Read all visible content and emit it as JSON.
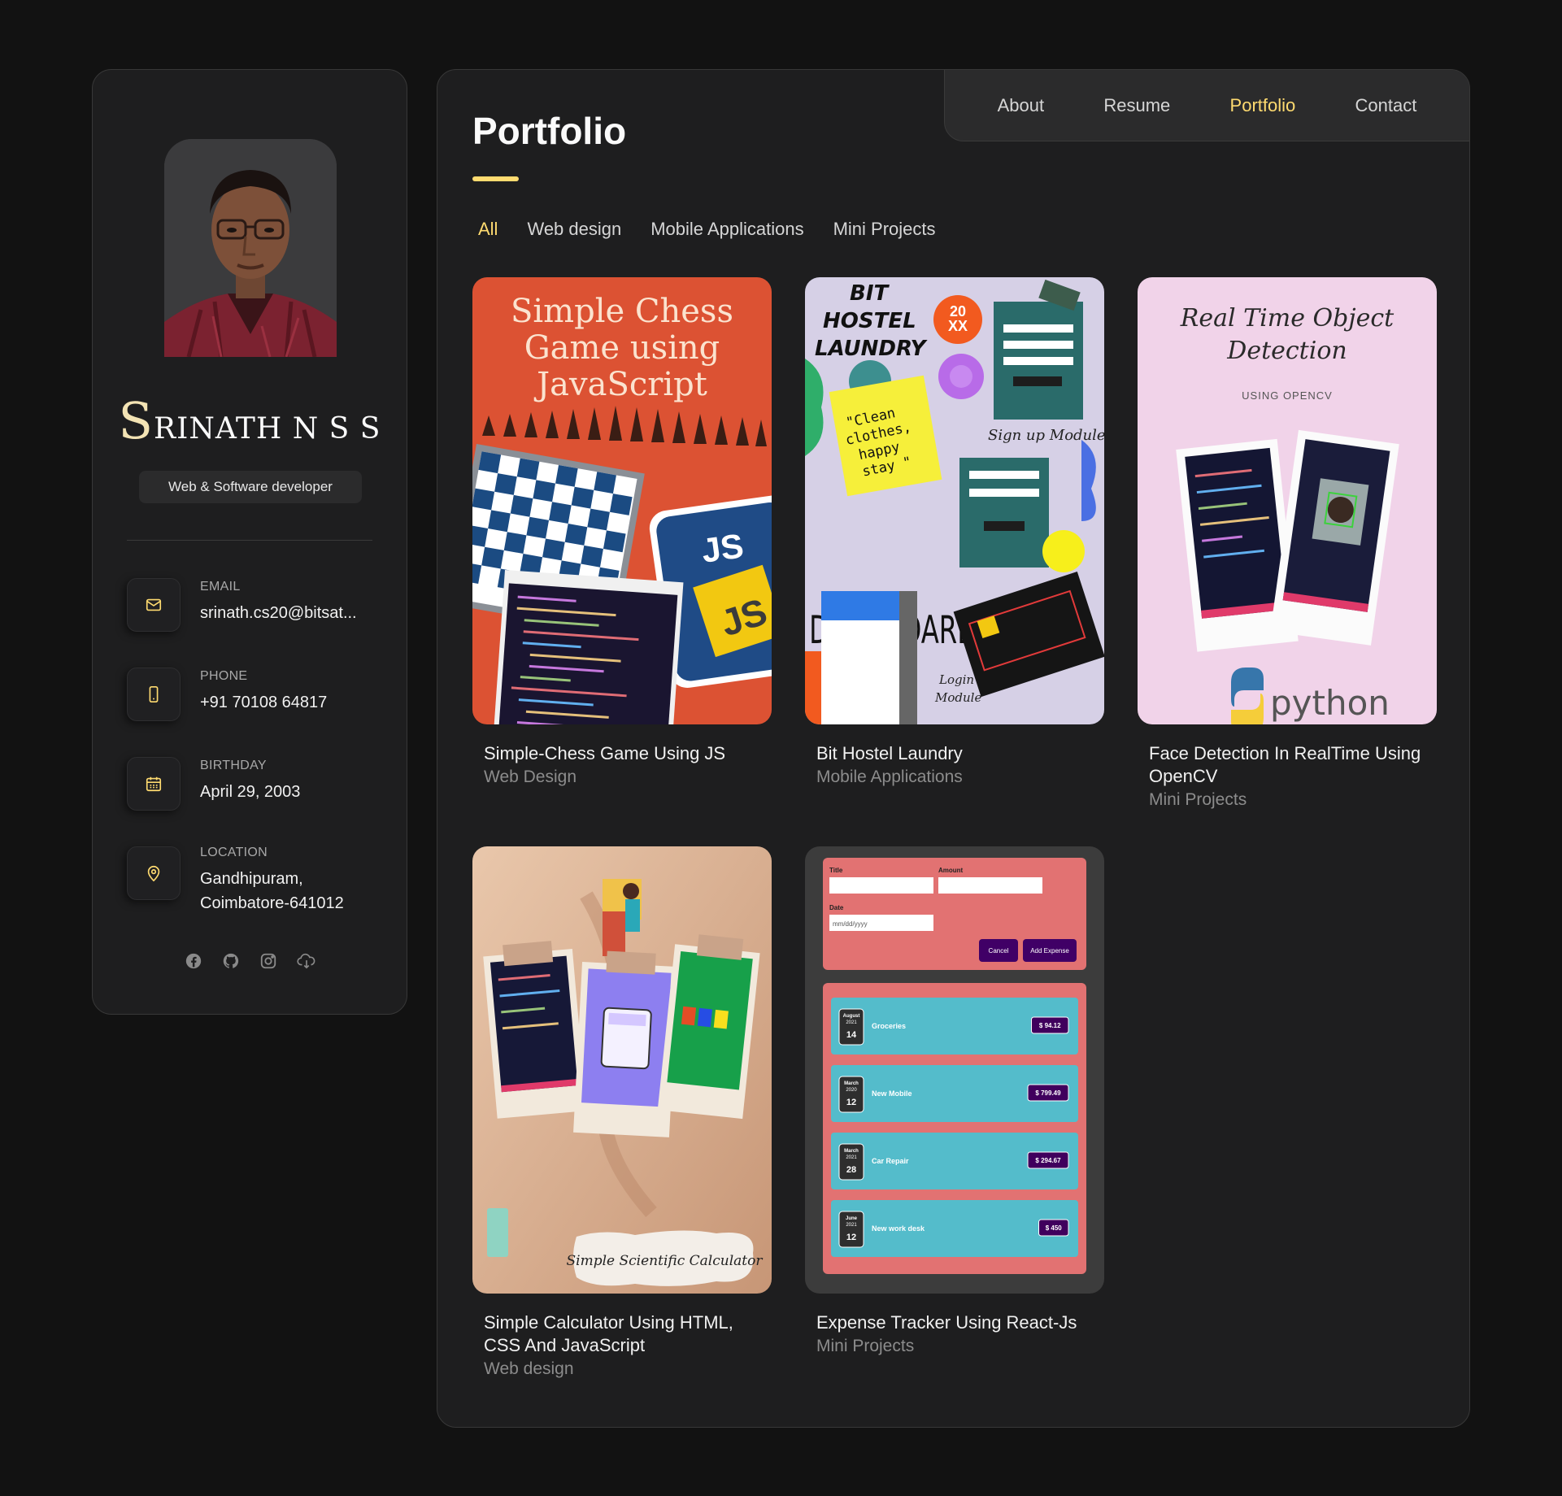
{
  "profile": {
    "name_initial": "S",
    "name_rest": "RINATH N S S",
    "title": "Web & Software developer"
  },
  "contacts": [
    {
      "label": "EMAIL",
      "value": "srinath.cs20@bitsat..."
    },
    {
      "label": "PHONE",
      "value": "+91 70108 64817"
    },
    {
      "label": "BIRTHDAY",
      "value": "April 29, 2003"
    },
    {
      "label": "LOCATION",
      "value": "Gandhipuram,",
      "value2": "Coimbatore-641012"
    }
  ],
  "socials": [
    "facebook-icon",
    "github-icon",
    "instagram-icon",
    "cloud-download-icon"
  ],
  "nav": [
    {
      "label": "About",
      "active": false
    },
    {
      "label": "Resume",
      "active": false
    },
    {
      "label": "Portfolio",
      "active": true
    },
    {
      "label": "Contact",
      "active": false
    }
  ],
  "page_title": "Portfolio",
  "filters": [
    {
      "label": "All",
      "active": true
    },
    {
      "label": "Web design",
      "active": false
    },
    {
      "label": "Mobile Applications",
      "active": false
    },
    {
      "label": "Mini Projects",
      "active": false
    }
  ],
  "projects": [
    {
      "title": "Simple-Chess Game Using JS",
      "category": "Web Design",
      "image_text": [
        "Simple Chess",
        "Game using",
        "JavaScript"
      ],
      "badge": "JS"
    },
    {
      "title": "Bit Hostel Laundry",
      "category": "Mobile Applications",
      "image_text": [
        "BIT",
        "HOSTEL",
        "LAUNDRY"
      ],
      "image_badge": [
        "20",
        "XX"
      ],
      "image_note": [
        "\"Clean",
        "clothes,",
        "happy",
        "stay \""
      ],
      "image_labels": {
        "signup": "Sign up Module",
        "dashboard": "DASHBOARD",
        "login": "Login",
        "login2": "Module"
      }
    },
    {
      "title_line1": "Face Detection In RealTime Using",
      "title_line2": "OpenCV",
      "category": "Mini Projects",
      "image_text": [
        "Real Time Object",
        "Detection"
      ],
      "image_sub": "USING OPENCV",
      "image_brand": "python"
    },
    {
      "title_line1": "Simple Calculator Using HTML,",
      "title_line2": "CSS And JavaScript",
      "category": "Web design",
      "image_text": "Simple Scientific Calculator"
    },
    {
      "title": "Expense Tracker Using React-Js",
      "category": "Mini Projects",
      "form": {
        "title": "Title",
        "amount": "Amount",
        "date": "Date",
        "date_placeholder": "mm/dd/yyyy",
        "cancel": "Cancel",
        "add": "Add Expense"
      },
      "expenses": [
        {
          "month": "August",
          "year": "2021",
          "day": "14",
          "name": "Groceries",
          "amount": "$ 94.12"
        },
        {
          "month": "March",
          "year": "2020",
          "day": "12",
          "name": "New Mobile",
          "amount": "$ 799.49"
        },
        {
          "month": "March",
          "year": "2021",
          "day": "28",
          "name": "Car Repair",
          "amount": "$ 294.67"
        },
        {
          "month": "June",
          "year": "2021",
          "day": "12",
          "name": "New work desk",
          "amount": "$ 450"
        }
      ]
    }
  ],
  "colors": {
    "accent": "#ffdb70",
    "bg": "#121212",
    "panel": "#1e1e1f"
  }
}
